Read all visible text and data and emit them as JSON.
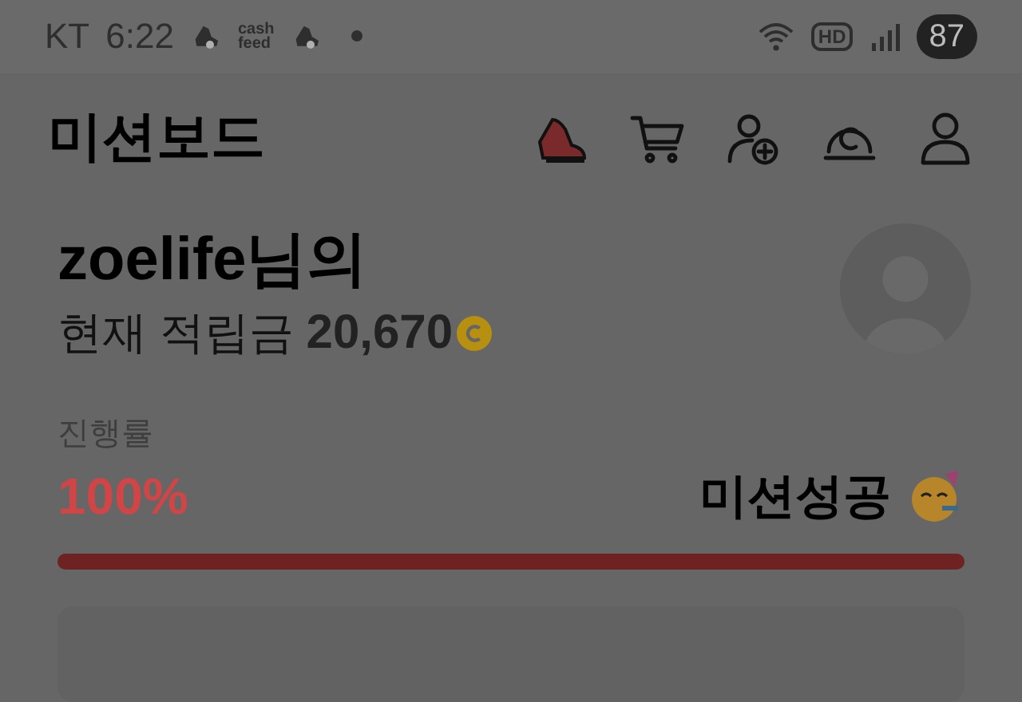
{
  "status_bar": {
    "carrier": "KT",
    "time": "6:22",
    "app_badge": [
      "cash",
      "feed"
    ],
    "hd": "HD",
    "battery": "87"
  },
  "header": {
    "title": "미션보드"
  },
  "profile": {
    "name": "zoelife님의",
    "balance_label": "현재 적립금",
    "balance": "20,670"
  },
  "progress": {
    "label": "진행률",
    "percent": "100%",
    "status": "미션성공",
    "level": 1
  }
}
